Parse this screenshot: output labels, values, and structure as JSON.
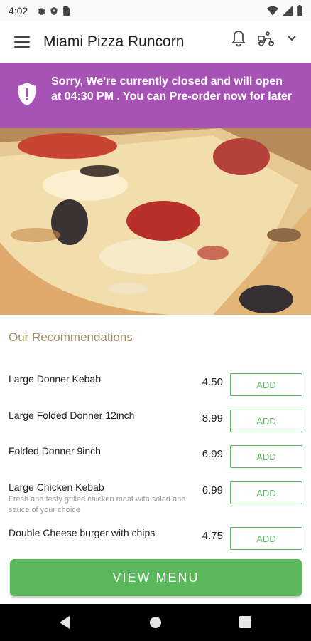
{
  "status_bar": {
    "time": "4:02"
  },
  "toolbar": {
    "title": "Miami Pizza Runcorn"
  },
  "banner": {
    "message": "Sorry, We're currently closed and will open at 04:30 PM . You can Pre-order now for later"
  },
  "recommendations": {
    "title": "Our Recommendations",
    "items": [
      {
        "name": "Large Donner Kebab",
        "price": "4.50",
        "add_label": "ADD"
      },
      {
        "name": "Large Folded Donner 12inch",
        "price": "8.99",
        "add_label": "ADD"
      },
      {
        "name": "Folded Donner 9inch",
        "price": "6.99",
        "add_label": "ADD"
      },
      {
        "name": "Large Chicken Kebab",
        "desc": "Fresh and testy grilled chicken meat with salad and sauce of your choice",
        "price": "6.99",
        "add_label": "ADD"
      },
      {
        "name": "Double Cheese burger with chips",
        "price": "4.75",
        "add_label": "ADD"
      }
    ]
  },
  "view_menu_label": "VIEW MENU",
  "colors": {
    "banner": "#a653b5",
    "accent_green": "#5cb85c",
    "section_title": "#9d8f66"
  },
  "icons": [
    "settings-icon",
    "shield-icon",
    "sim-card-icon",
    "wifi-icon",
    "signal-icon",
    "battery-icon",
    "menu-icon",
    "bell-icon",
    "delivery-icon",
    "chevron-down-icon",
    "back-icon",
    "home-icon",
    "recents-icon"
  ]
}
